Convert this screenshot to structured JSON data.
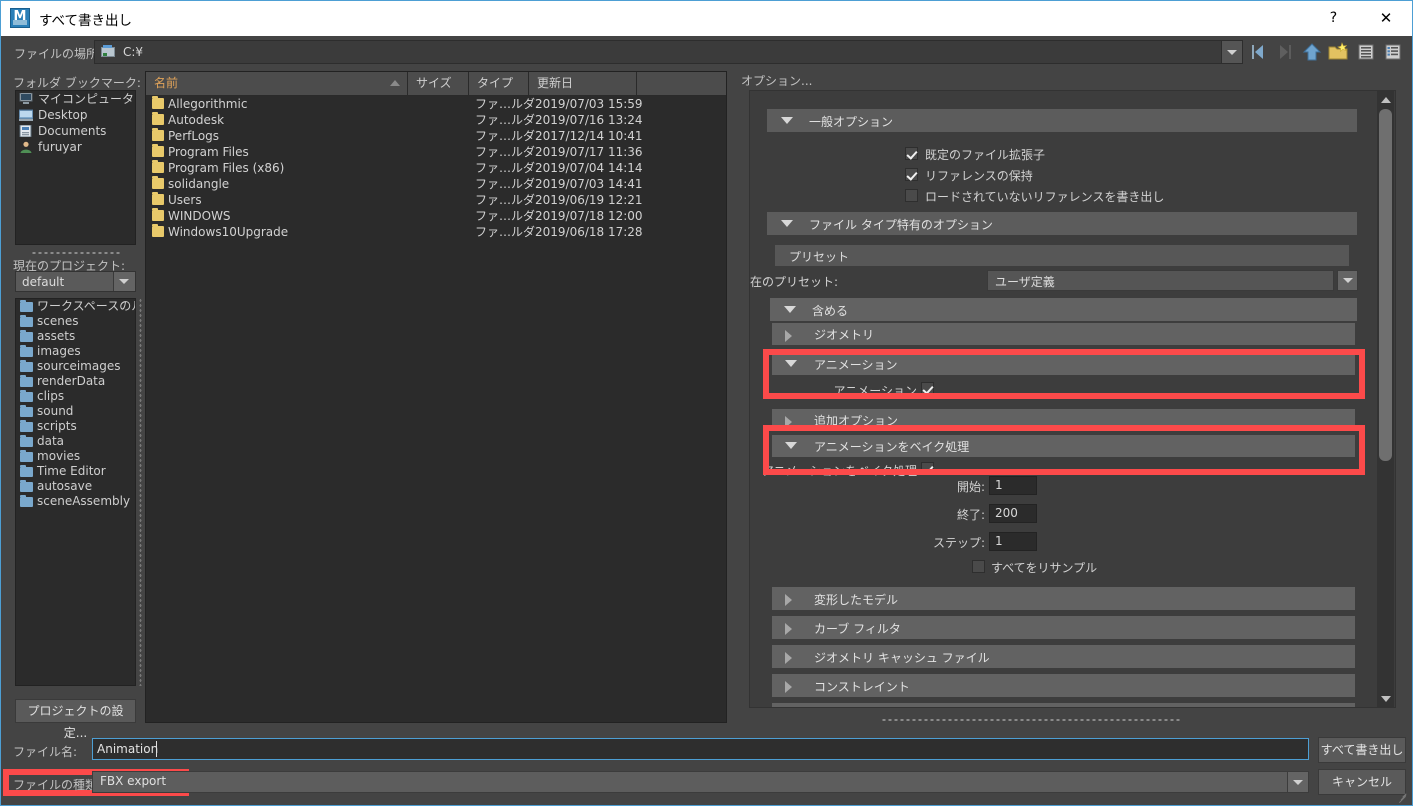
{
  "window": {
    "title": "すべて書き出し",
    "app_icon": "maya-icon",
    "help_label": "?",
    "close_label": "✕"
  },
  "pathbar": {
    "label": "ファイルの場所:",
    "value": "C:¥",
    "drive_icon": "drive-icon",
    "dropdown_icon": "chevron-down-icon",
    "tools": [
      {
        "name": "nav-back-icon",
        "title": "戻る"
      },
      {
        "name": "nav-forward-icon",
        "title": "進む"
      },
      {
        "name": "nav-up-icon",
        "title": "上へ"
      },
      {
        "name": "new-folder-icon",
        "title": "新しいフォルダ"
      },
      {
        "name": "list-view-icon",
        "title": "リスト表示"
      },
      {
        "name": "detail-view-icon",
        "title": "詳細表示"
      }
    ]
  },
  "sidebar": {
    "bookmarks_label": "フォルダ ブックマーク:",
    "bookmarks": [
      {
        "label": "マイコンピュータ",
        "icon": "computer-icon"
      },
      {
        "label": "Desktop",
        "icon": "desktop-icon"
      },
      {
        "label": "Documents",
        "icon": "documents-icon"
      },
      {
        "label": "furuyar",
        "icon": "user-icon"
      }
    ],
    "project_label": "現在のプロジェクト:",
    "project_value": "default",
    "project_folders": [
      "ワークスペースのルート",
      "scenes",
      "assets",
      "images",
      "sourceimages",
      "renderData",
      "clips",
      "sound",
      "scripts",
      "data",
      "movies",
      "Time Editor",
      "autosave",
      "sceneAssembly"
    ],
    "project_settings_button": "プロジェクトの設定..."
  },
  "filelist": {
    "columns": [
      "名前",
      "サイズ",
      "タイプ",
      "更新日"
    ],
    "sorted_column": "名前",
    "rows": [
      {
        "name": "Allegorithmic",
        "size": "",
        "type": "ファ…ルダ",
        "date": "2019/07/03 15:59"
      },
      {
        "name": "Autodesk",
        "size": "",
        "type": "ファ…ルダ",
        "date": "2019/07/16 13:24"
      },
      {
        "name": "PerfLogs",
        "size": "",
        "type": "ファ…ルダ",
        "date": "2017/12/14 10:41"
      },
      {
        "name": "Program Files",
        "size": "",
        "type": "ファ…ルダ",
        "date": "2019/07/17 11:36"
      },
      {
        "name": "Program Files (x86)",
        "size": "",
        "type": "ファ…ルダ",
        "date": "2019/07/04 14:14"
      },
      {
        "name": "solidangle",
        "size": "",
        "type": "ファ…ルダ",
        "date": "2019/07/03 14:41"
      },
      {
        "name": "Users",
        "size": "",
        "type": "ファ…ルダ",
        "date": "2019/06/19 12:21"
      },
      {
        "name": "WINDOWS",
        "size": "",
        "type": "ファ…ルダ",
        "date": "2019/07/18 12:00"
      },
      {
        "name": "Windows10Upgrade",
        "size": "",
        "type": "ファ…ルダ",
        "date": "2019/06/18 17:28"
      }
    ]
  },
  "options": {
    "title": "オプション...",
    "general": {
      "header": "一般オプション",
      "checkboxes": [
        {
          "label": "既定のファイル拡張子",
          "checked": true
        },
        {
          "label": "リファレンスの保持",
          "checked": true
        },
        {
          "label": "ロードされていないリファレンスを書き出し",
          "checked": false
        }
      ]
    },
    "filetype": {
      "header": "ファイル タイプ特有のオプション",
      "preset_bar": "プリセット",
      "current_preset_label": "現在のプリセット:",
      "current_preset_value": "ユーザ定義"
    },
    "include_header": "含める",
    "geometry_header": "ジオメトリ",
    "animation_header": "アニメーション",
    "animation_checkbox": {
      "label": "アニメーション",
      "checked": true
    },
    "extra_options_header": "追加オプション",
    "bake_header": "アニメーションをベイク処理",
    "bake_checkbox": {
      "label": "アニメーションをベイク処理",
      "checked": true
    },
    "fields": [
      {
        "label": "開始:",
        "value": "1"
      },
      {
        "label": "終了:",
        "value": "200"
      },
      {
        "label": "ステップ:",
        "value": "1"
      }
    ],
    "resample_checkbox": {
      "label": "すべてをリサンプル",
      "checked": false
    },
    "collapsed_sections": [
      "変形したモデル",
      "カーブ フィルタ",
      "ジオメトリ キャッシュ ファイル",
      "コンストレイント"
    ],
    "highlight_color": "#fc4a4a",
    "scrollbar": {
      "up_icon": "scroll-up-icon",
      "down_icon": "scroll-down-icon"
    }
  },
  "footer": {
    "filename_label": "ファイル名:",
    "filename_value": "Animation",
    "filetype_label": "ファイルの種類:",
    "filetype_value": "FBX export",
    "filetype_dropdown_icon": "chevron-down-icon",
    "export_button": "すべて書き出し",
    "cancel_button": "キャンセル"
  }
}
